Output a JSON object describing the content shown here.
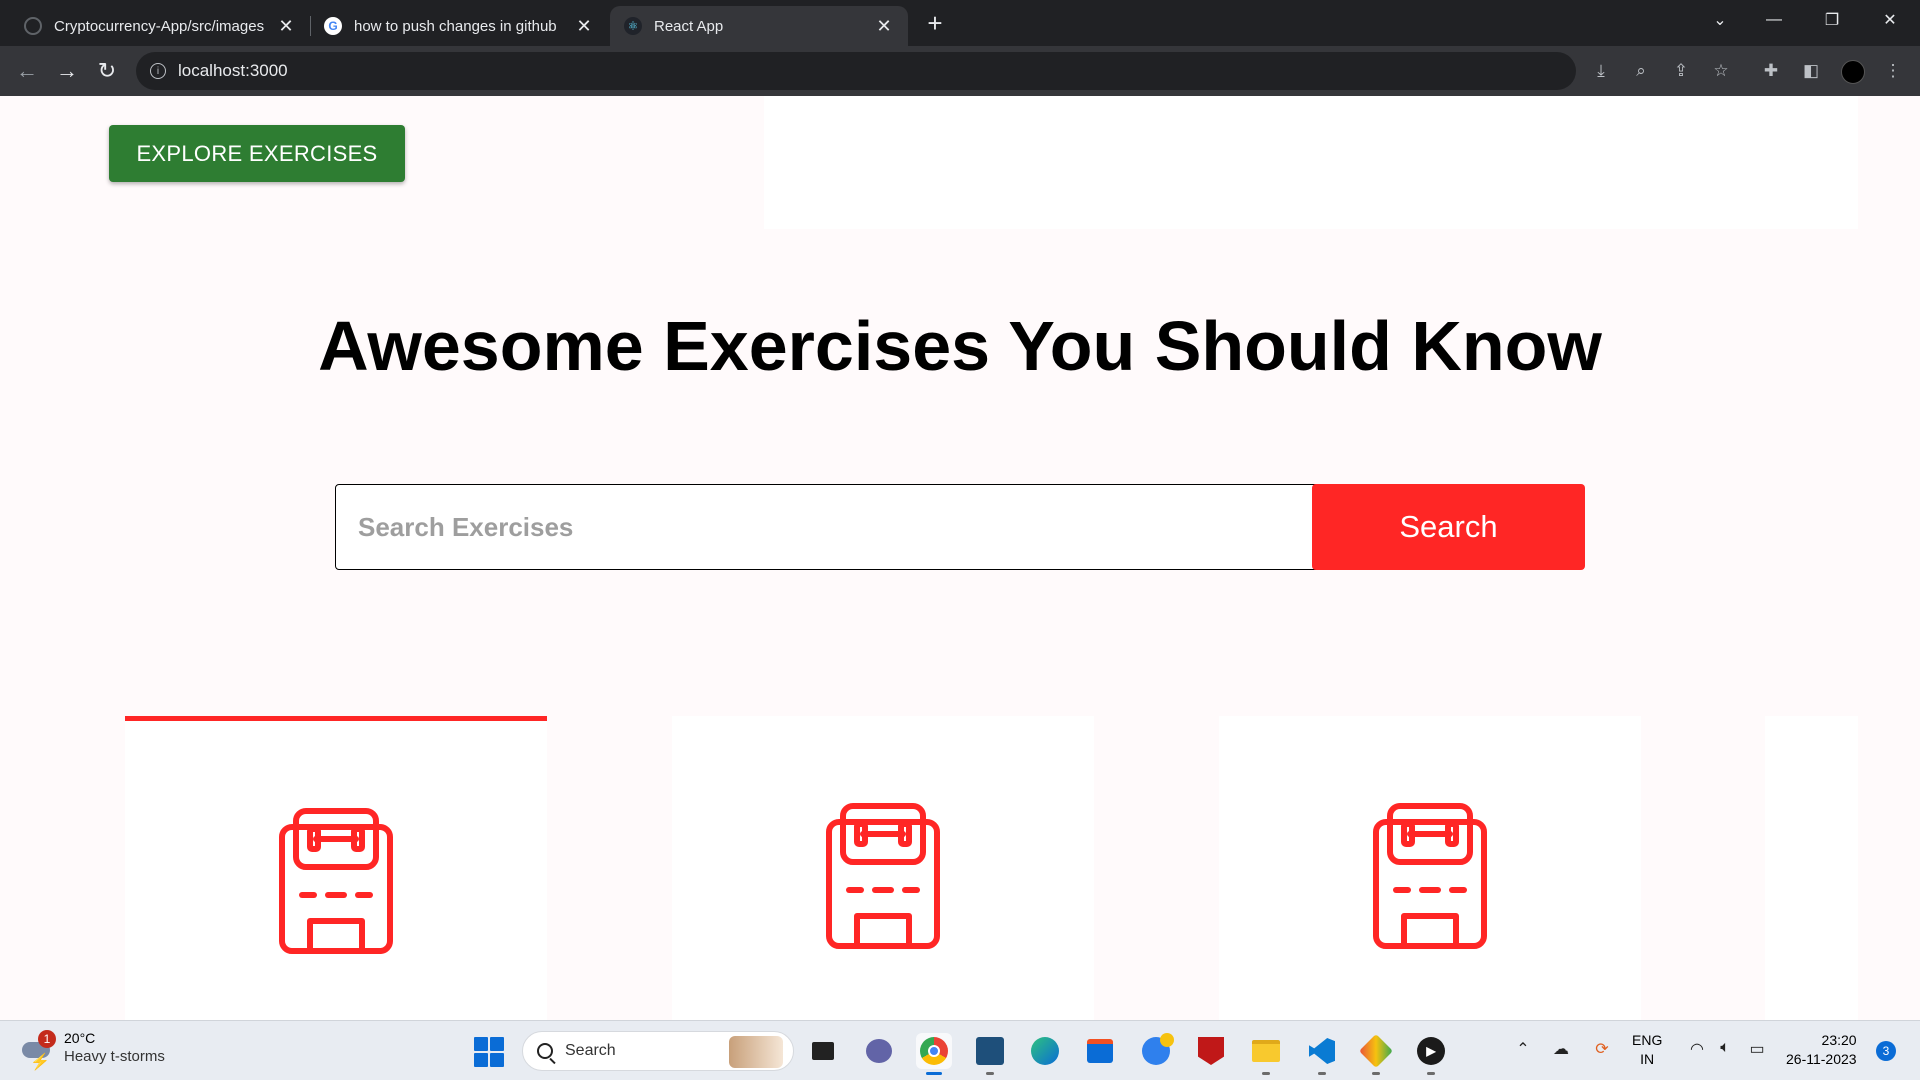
{
  "browser": {
    "tabs": [
      {
        "title": "Cryptocurrency-App/src/images",
        "favicon": "github-icon",
        "active": false
      },
      {
        "title": "how to push changes in github",
        "favicon": "google-icon",
        "active": false
      },
      {
        "title": "React App",
        "favicon": "react-icon",
        "active": true
      }
    ],
    "address": "localhost:3000"
  },
  "page": {
    "explore_button": "EXPLORE EXERCISES",
    "heading": "Awesome Exercises You Should Know",
    "search": {
      "placeholder": "Search Exercises",
      "value": "",
      "button_label": "Search"
    },
    "category_cards": [
      {
        "icon": "gym-icon",
        "selected": true
      },
      {
        "icon": "gym-icon",
        "selected": false
      },
      {
        "icon": "gym-icon",
        "selected": false
      }
    ],
    "colors": {
      "accent": "#FF2625",
      "explore": "#2E7D32",
      "background": "#FFFAFB"
    }
  },
  "taskbar": {
    "weather": {
      "temp": "20°C",
      "condition": "Heavy t-storms",
      "badge": "1"
    },
    "search_label": "Search",
    "language": {
      "line1": "ENG",
      "line2": "IN"
    },
    "clock": {
      "time": "23:20",
      "date": "26-11-2023"
    },
    "notifications": "3"
  }
}
